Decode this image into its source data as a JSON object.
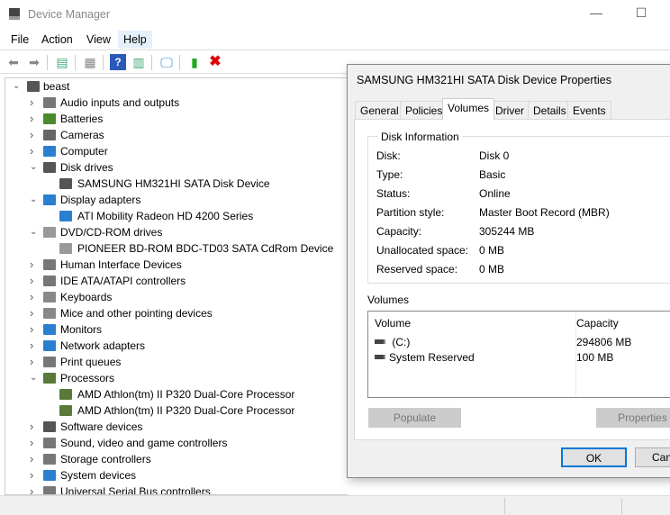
{
  "window": {
    "title": "Device Manager",
    "minimize": "—",
    "maximize": "☐"
  },
  "menu": [
    "File",
    "Action",
    "View",
    "Help"
  ],
  "toolbar": [
    "back-icon",
    "forward-icon",
    "show-hide-console-tree-icon",
    "properties-icon",
    "help-icon",
    "action-pane-icon",
    "scan-hardware-icon",
    "update-driver-icon",
    "uninstall-icon"
  ],
  "tree": {
    "root": "beast",
    "rows": [
      {
        "label": "Audio inputs and outputs",
        "level": 1,
        "expanded": false,
        "color": "#777"
      },
      {
        "label": "Batteries",
        "level": 1,
        "expanded": false,
        "color": "#4a8a2a"
      },
      {
        "label": "Cameras",
        "level": 1,
        "expanded": false,
        "color": "#666"
      },
      {
        "label": "Computer",
        "level": 1,
        "expanded": false,
        "color": "#2a7fd0"
      },
      {
        "label": "Disk drives",
        "level": 1,
        "expanded": true,
        "color": "#555"
      },
      {
        "label": "SAMSUNG HM321HI SATA Disk Device",
        "level": 2,
        "color": "#555"
      },
      {
        "label": "Display adapters",
        "level": 1,
        "expanded": true,
        "color": "#2a7fd0"
      },
      {
        "label": "ATI Mobility Radeon HD 4200 Series",
        "level": 2,
        "color": "#2a7fd0"
      },
      {
        "label": "DVD/CD-ROM drives",
        "level": 1,
        "expanded": true,
        "color": "#999"
      },
      {
        "label": "PIONEER BD-ROM  BDC-TD03 SATA CdRom Device",
        "level": 2,
        "color": "#999"
      },
      {
        "label": "Human Interface Devices",
        "level": 1,
        "expanded": false,
        "color": "#777"
      },
      {
        "label": "IDE ATA/ATAPI controllers",
        "level": 1,
        "expanded": false,
        "color": "#777"
      },
      {
        "label": "Keyboards",
        "level": 1,
        "expanded": false,
        "color": "#888"
      },
      {
        "label": "Mice and other pointing devices",
        "level": 1,
        "expanded": false,
        "color": "#888"
      },
      {
        "label": "Monitors",
        "level": 1,
        "expanded": false,
        "color": "#2a7fd0"
      },
      {
        "label": "Network adapters",
        "level": 1,
        "expanded": false,
        "color": "#2a7fd0"
      },
      {
        "label": "Print queues",
        "level": 1,
        "expanded": false,
        "color": "#777"
      },
      {
        "label": "Processors",
        "level": 1,
        "expanded": true,
        "color": "#5a7a3a"
      },
      {
        "label": "AMD Athlon(tm) II P320 Dual-Core Processor",
        "level": 2,
        "color": "#5a7a3a"
      },
      {
        "label": "AMD Athlon(tm) II P320 Dual-Core Processor",
        "level": 2,
        "color": "#5a7a3a"
      },
      {
        "label": "Software devices",
        "level": 1,
        "expanded": false,
        "color": "#555"
      },
      {
        "label": "Sound, video and game controllers",
        "level": 1,
        "expanded": false,
        "color": "#777"
      },
      {
        "label": "Storage controllers",
        "level": 1,
        "expanded": false,
        "color": "#777"
      },
      {
        "label": "System devices",
        "level": 1,
        "expanded": false,
        "color": "#2a7fd0"
      },
      {
        "label": "Universal Serial Bus controllers",
        "level": 1,
        "expanded": false,
        "color": "#777"
      }
    ]
  },
  "dialog": {
    "title": "SAMSUNG HM321HI SATA Disk Device Properties",
    "tabs": [
      "General",
      "Policies",
      "Volumes",
      "Driver",
      "Details",
      "Events"
    ],
    "selected_tab": "Volumes",
    "disk_info_title": "Disk Information",
    "disk_info": [
      {
        "label": "Disk:",
        "value": "Disk 0"
      },
      {
        "label": "Type:",
        "value": "Basic"
      },
      {
        "label": "Status:",
        "value": "Online"
      },
      {
        "label": "Partition style:",
        "value": "Master Boot Record (MBR)"
      },
      {
        "label": "Capacity:",
        "value": "305244 MB"
      },
      {
        "label": "Unallocated space:",
        "value": "0 MB"
      },
      {
        "label": "Reserved space:",
        "value": "0 MB"
      }
    ],
    "volumes_title": "Volumes",
    "columns": [
      "Volume",
      "Capacity"
    ],
    "volumes": [
      {
        "name": " (C:)",
        "capacity": "294806 MB"
      },
      {
        "name": "System Reserved",
        "capacity": "100 MB"
      }
    ],
    "populate": "Populate",
    "properties": "Properties",
    "ok": "OK",
    "cancel": "Cancel"
  }
}
